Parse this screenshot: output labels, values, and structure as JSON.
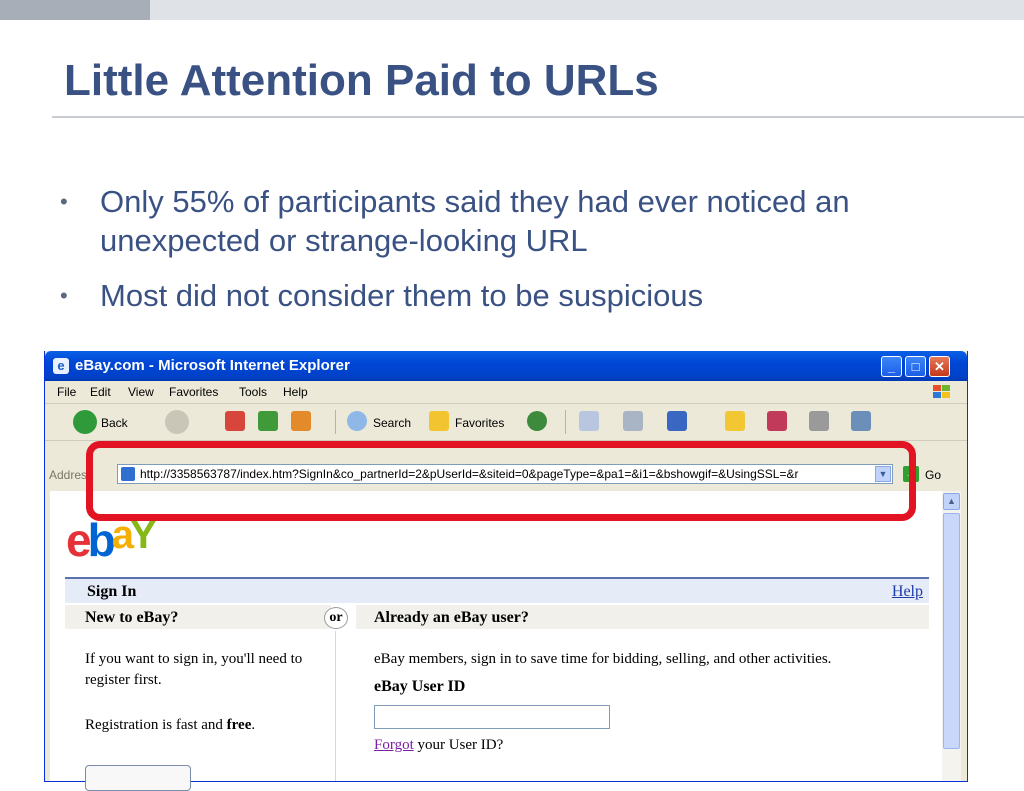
{
  "slide": {
    "title": "Little Attention Paid to URLs",
    "bullet_symbol": "•",
    "bullets": [
      "Only 55% of participants said they had ever noticed an unexpected or strange-looking URL",
      "Most did not consider them to be suspicious"
    ],
    "colors": {
      "title": "#3a5283",
      "highlight": "#e21322"
    }
  },
  "browser": {
    "window_title": "eBay.com - Microsoft Internet Explorer",
    "menu": [
      "File",
      "Edit",
      "View",
      "Favorites",
      "Tools",
      "Help"
    ],
    "toolbar": {
      "back_label": "Back",
      "search_label": "Search",
      "favorites_label": "Favorites"
    },
    "address": {
      "label": "Address",
      "url": "http://3358563787/index.htm?SignIn&co_partnerId=2&pUserId=&siteid=0&pageType=&pa1=&i1=&bshowgif=&UsingSSL=&r",
      "go_label": "Go"
    }
  },
  "page": {
    "logo": {
      "e": "e",
      "b": "b",
      "a": "a",
      "y": "Y"
    },
    "signin_title": "Sign In",
    "help_label": "Help",
    "or_label": "or",
    "new_user": {
      "heading": "New to eBay?",
      "text": "If you want to sign in, you'll need to register first.",
      "reg_prefix": "Registration is fast and ",
      "reg_bold": "free",
      "reg_suffix": "."
    },
    "existing_user": {
      "heading": "Already an eBay user?",
      "text": "eBay members, sign in to save time for bidding, selling, and other activities.",
      "userid_label": "eBay User ID",
      "forgot_link": "Forgot",
      "forgot_suffix": " your User ID?"
    }
  }
}
